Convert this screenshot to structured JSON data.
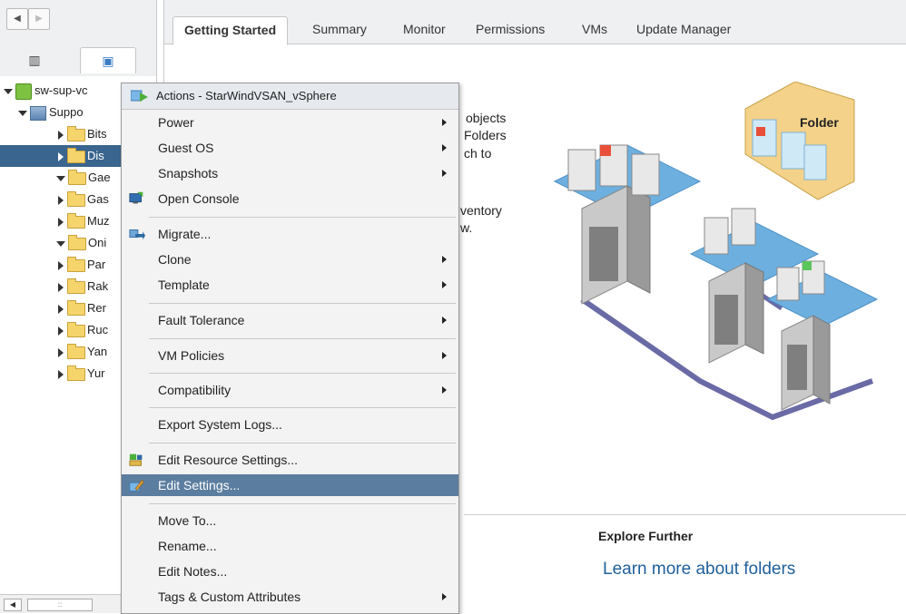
{
  "tree": {
    "root": "sw-sup-vc",
    "datacenter": "Suppo",
    "folders": [
      {
        "label": "Bits",
        "state": "closed"
      },
      {
        "label": "Dis",
        "state": "closed",
        "selected": true
      },
      {
        "label": "Gae",
        "state": "open"
      },
      {
        "label": "Gas",
        "state": "closed"
      },
      {
        "label": "Muz",
        "state": "closed"
      },
      {
        "label": "Oni",
        "state": "open"
      },
      {
        "label": "Par",
        "state": "closed"
      },
      {
        "label": "Rak",
        "state": "closed"
      },
      {
        "label": "Rer",
        "state": "closed"
      },
      {
        "label": "Ruc",
        "state": "closed"
      },
      {
        "label": "Yan",
        "state": "closed"
      },
      {
        "label": "Yur",
        "state": "closed"
      }
    ]
  },
  "tabs": [
    "Getting Started",
    "Summary",
    "Monitor",
    "Permissions",
    "VMs",
    "Update Manager"
  ],
  "hint_lines": [
    "objects",
    "Folders",
    "ch to",
    "ventory",
    "w."
  ],
  "illustration": {
    "folder_label": "Folder"
  },
  "explore": {
    "heading": "Explore Further",
    "link": "Learn more about folders"
  },
  "context_menu": {
    "header": "Actions - StarWindVSAN_vSphere",
    "items": [
      {
        "label": "Power",
        "submenu": true
      },
      {
        "label": "Guest OS",
        "submenu": true
      },
      {
        "label": "Snapshots",
        "submenu": true
      },
      {
        "label": "Open Console",
        "submenu": false,
        "icon": "console-icon"
      },
      {
        "label": "Migrate...",
        "submenu": false,
        "icon": "migrate-icon"
      },
      {
        "label": "Clone",
        "submenu": true
      },
      {
        "label": "Template",
        "submenu": true
      },
      {
        "label": "Fault Tolerance",
        "submenu": true
      },
      {
        "label": "VM Policies",
        "submenu": true
      },
      {
        "label": "Compatibility",
        "submenu": true
      },
      {
        "label": "Export System Logs...",
        "submenu": false
      },
      {
        "label": "Edit Resource Settings...",
        "submenu": false,
        "icon": "resource-settings-icon"
      },
      {
        "label": "Edit Settings...",
        "submenu": false,
        "icon": "edit-settings-icon",
        "highlighted": true
      },
      {
        "label": "Move To...",
        "submenu": false
      },
      {
        "label": "Rename...",
        "submenu": false
      },
      {
        "label": "Edit Notes...",
        "submenu": false
      },
      {
        "label": "Tags & Custom Attributes",
        "submenu": true
      }
    ]
  },
  "colors": {
    "selection": "#39658e",
    "menu_highlight": "#5b7d9f",
    "link": "#1f5f9b"
  }
}
